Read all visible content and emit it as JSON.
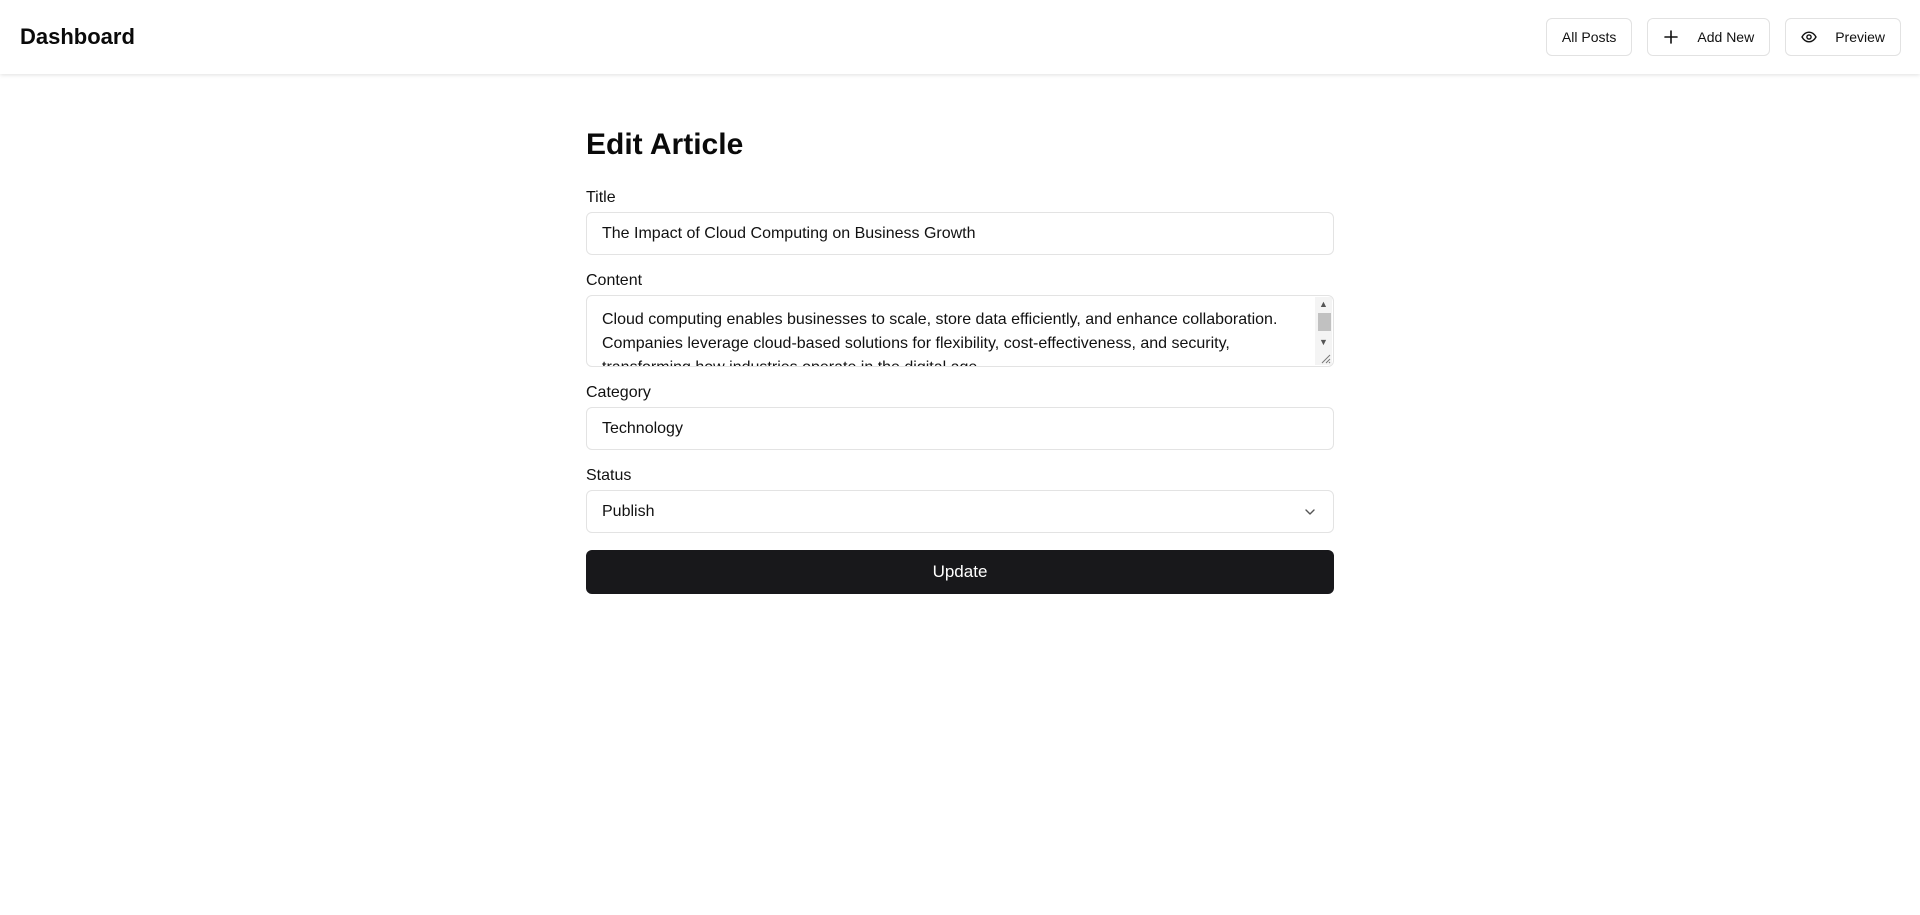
{
  "header": {
    "brand": "Dashboard",
    "nav": {
      "all_posts": "All Posts",
      "add_new": "Add New",
      "preview": "Preview"
    },
    "icons": {
      "add_new": "plus-icon",
      "preview": "eye-icon"
    }
  },
  "form": {
    "page_title": "Edit Article",
    "title_label": "Title",
    "title_value": "The Impact of Cloud Computing on Business Growth",
    "content_label": "Content",
    "content_value": "Cloud computing enables businesses to scale, store data efficiently, and enhance collaboration. Companies leverage cloud-based solutions for flexibility, cost-effectiveness, and security, transforming how industries operate in the digital age.",
    "category_label": "Category",
    "category_value": "Technology",
    "status_label": "Status",
    "status_value": "Publish",
    "submit_label": "Update"
  },
  "colors": {
    "primary_button": "#18181b",
    "border": "#e3e3e3"
  }
}
